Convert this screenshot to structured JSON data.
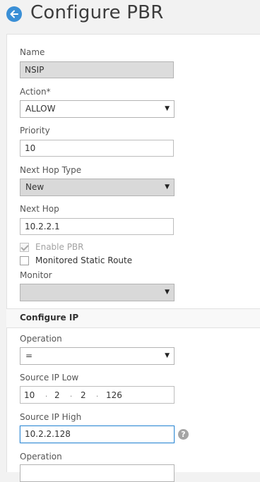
{
  "header": {
    "title": "Configure PBR",
    "back_icon": "arrow-left-icon"
  },
  "form": {
    "name": {
      "label": "Name",
      "value": "NSIP"
    },
    "action": {
      "label": "Action*",
      "value": "ALLOW"
    },
    "priority": {
      "label": "Priority",
      "value": "10"
    },
    "next_hop_type": {
      "label": "Next Hop Type",
      "value": "New"
    },
    "next_hop": {
      "label": "Next Hop",
      "value": "10.2.2.1"
    },
    "enable_pbr": {
      "label": "Enable PBR",
      "checked": true,
      "disabled": true
    },
    "monitored_static_route": {
      "label": "Monitored Static Route",
      "checked": false
    },
    "monitor": {
      "label": "Monitor",
      "value": ""
    }
  },
  "configure_ip": {
    "title": "Configure IP",
    "operation": {
      "label": "Operation",
      "value": "="
    },
    "source_ip_low": {
      "label": "Source IP Low",
      "octets": [
        "10",
        "2",
        "2",
        "126"
      ]
    },
    "source_ip_high": {
      "label": "Source IP High",
      "value": "10.2.2.128"
    },
    "operation2": {
      "label": "Operation",
      "value": ""
    }
  },
  "colors": {
    "accent": "#3a8fd6",
    "disabled_field": "#dcdcdc"
  }
}
